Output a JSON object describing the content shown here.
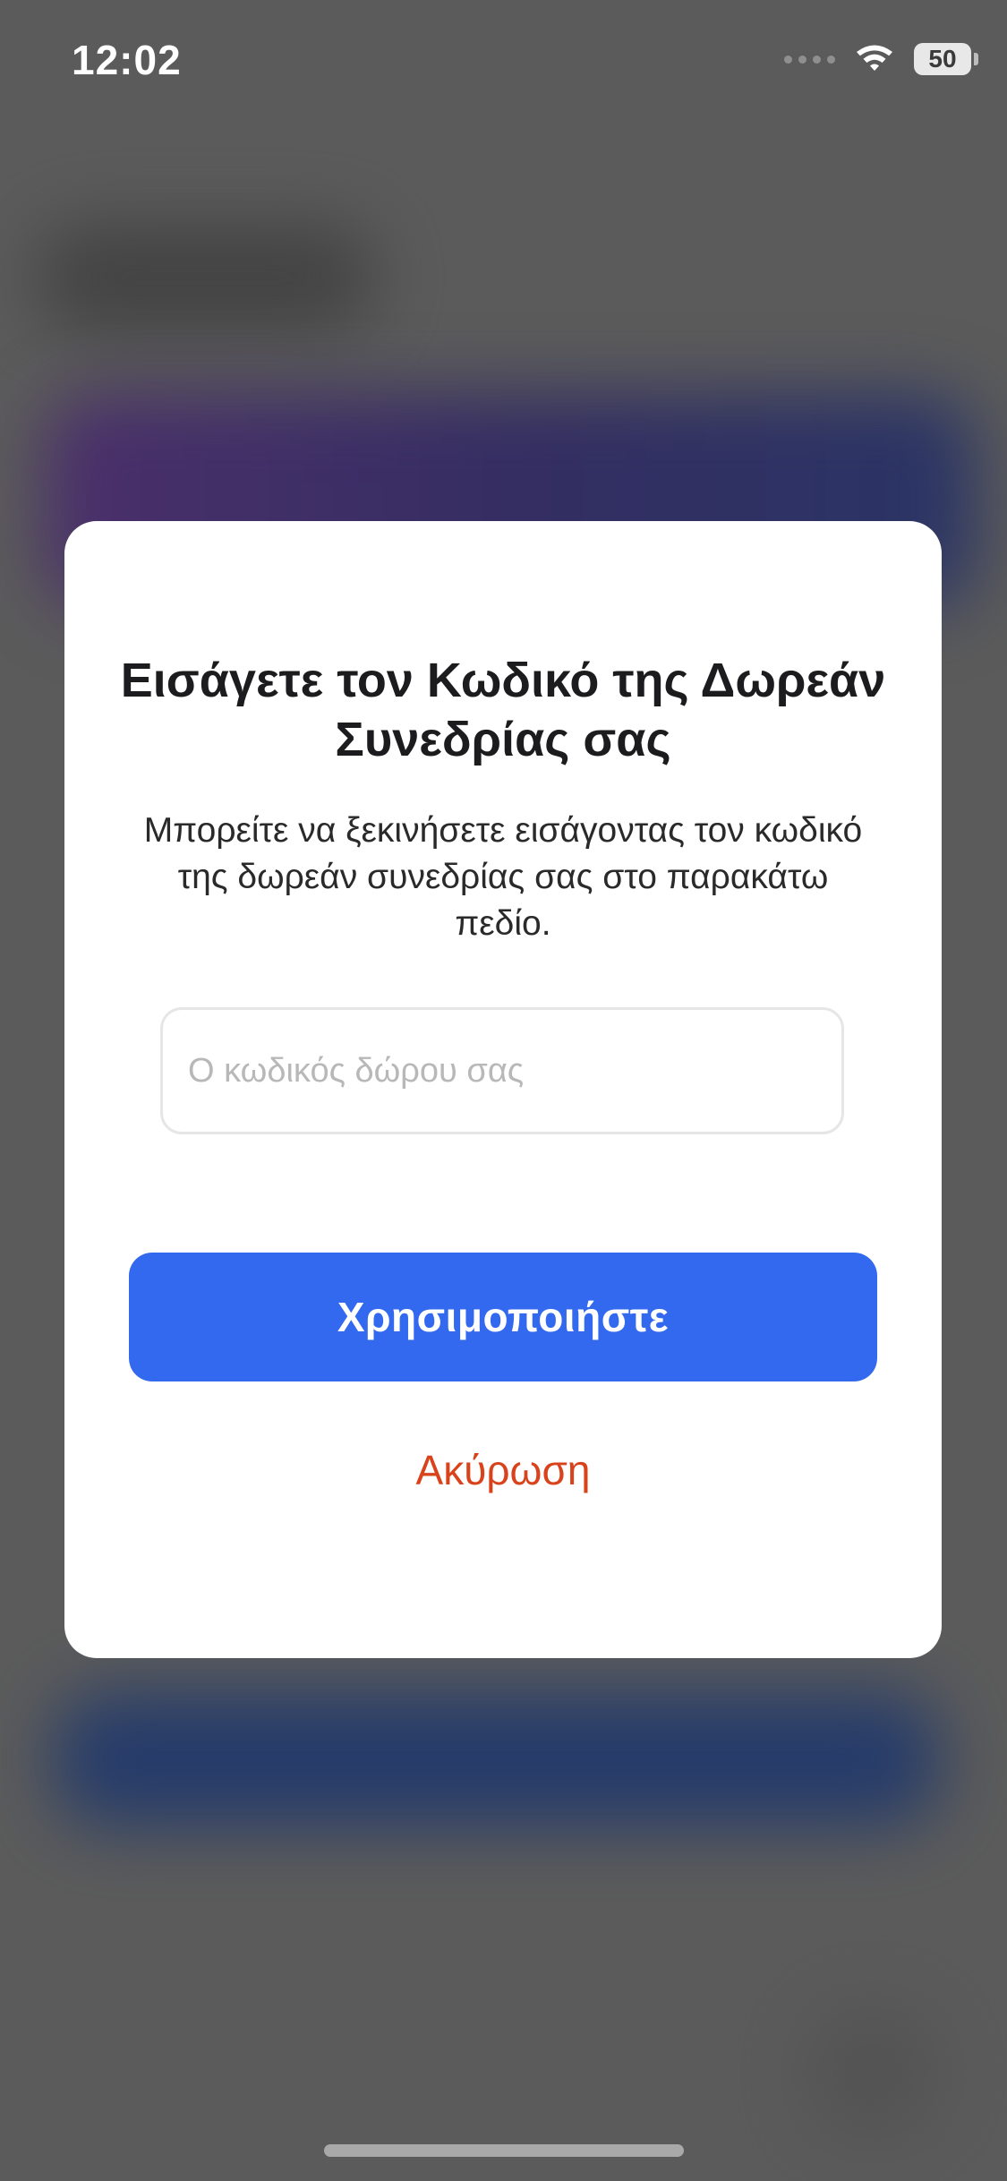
{
  "status_bar": {
    "time": "12:02",
    "battery_level": "50"
  },
  "modal": {
    "title": "Εισάγετε τον Κωδικό της Δωρεάν Συνεδρίας σας",
    "description": "Μπορείτε να ξεκινήσετε εισάγοντας τον κωδικό της δωρεάν συνεδρίας σας στο παρακάτω πεδίο.",
    "code_input": {
      "value": "",
      "placeholder": "Ο κωδικός δώρου σας"
    },
    "use_button_label": "Χρησιμοποιήστε",
    "cancel_button_label": "Ακύρωση"
  },
  "colors": {
    "primary": "#3369ef",
    "cancel": "#d9431c",
    "overlay": "#5b5b5b"
  },
  "icons": [
    "signal-icon",
    "wifi-icon",
    "battery-icon"
  ]
}
